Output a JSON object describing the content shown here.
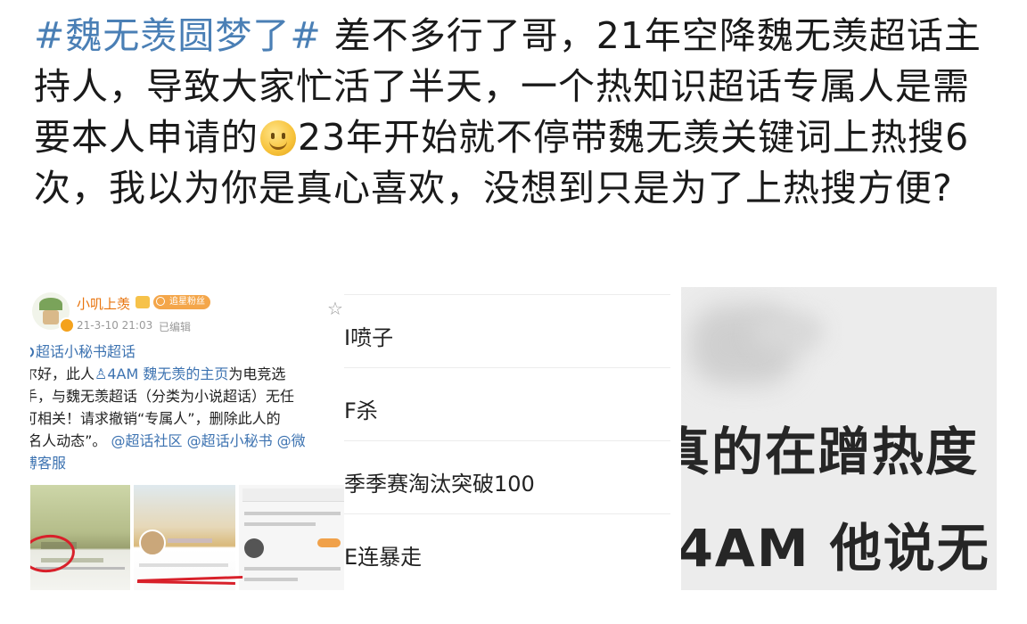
{
  "post": {
    "topic": "#魏无羡圆梦了#",
    "text_part1": " 差不多行了哥，21年空降魏无羡超话主持人，导致大家忙活了半天，一个热知识超话专属人是需要本人申请的",
    "emoji": "smile-emoji",
    "text_part2": "23年开始就不停带魏无羡关键词上热搜6次，我以为你是真心喜欢，没想到只是为了上热搜方便?"
  },
  "panel1": {
    "author": "小叽上羡",
    "tag": "追星粉丝",
    "time": "21-3-10 21:03",
    "edited": "已编辑",
    "topic": "超话小秘书超话",
    "line1a": "尔好，此人",
    "line1b": "4AM 魏无羡的主页",
    "line1c": "为电竞选",
    "line2": "手，与魏无羡超话（分类为小说超话）无任",
    "line3": "可相关！请求撤销“专属人”，删除此人的",
    "line4a": "‘名人动态”。",
    "line4b": "@超话社区 @超话小秘书 @微",
    "line5": "博客服"
  },
  "panel2": {
    "rows": [
      "I喷子",
      "F杀",
      "季季赛淘汰突破100",
      "E连暴走"
    ]
  },
  "panel3": {
    "line1": "真的在蹭热度",
    "line2": "J4AM 他说无"
  }
}
